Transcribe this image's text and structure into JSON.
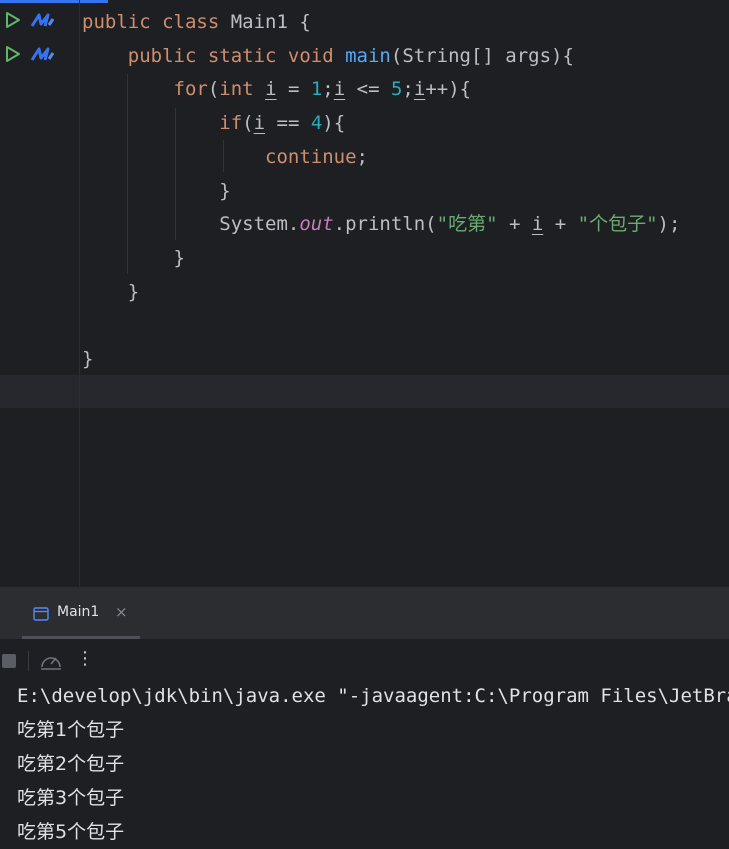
{
  "editor": {
    "code_lines": [
      [
        {
          "t": "public class ",
          "c": "kw"
        },
        {
          "t": "Main1 {",
          "c": ""
        }
      ],
      [
        {
          "t": "    public static void ",
          "c": "kw"
        },
        {
          "t": "main",
          "c": "fn"
        },
        {
          "t": "(String[] args){",
          "c": ""
        }
      ],
      [
        {
          "t": "        for",
          "c": "kw"
        },
        {
          "t": "(",
          "c": ""
        },
        {
          "t": "int ",
          "c": "kw"
        },
        {
          "t": "i",
          "c": "var"
        },
        {
          "t": " = ",
          "c": ""
        },
        {
          "t": "1",
          "c": "num"
        },
        {
          "t": ";",
          "c": ""
        },
        {
          "t": "i",
          "c": "var"
        },
        {
          "t": " <= ",
          "c": ""
        },
        {
          "t": "5",
          "c": "num"
        },
        {
          "t": ";",
          "c": ""
        },
        {
          "t": "i",
          "c": "var"
        },
        {
          "t": "++){",
          "c": ""
        }
      ],
      [
        {
          "t": "            if",
          "c": "kw"
        },
        {
          "t": "(",
          "c": ""
        },
        {
          "t": "i",
          "c": "var"
        },
        {
          "t": " == ",
          "c": ""
        },
        {
          "t": "4",
          "c": "num"
        },
        {
          "t": "){",
          "c": ""
        }
      ],
      [
        {
          "t": "                continue",
          "c": "kw"
        },
        {
          "t": ";",
          "c": ""
        }
      ],
      [
        {
          "t": "            }",
          "c": ""
        }
      ],
      [
        {
          "t": "            System.",
          "c": ""
        },
        {
          "t": "out",
          "c": "fld"
        },
        {
          "t": ".println(",
          "c": ""
        },
        {
          "t": "\"吃第\"",
          "c": "str"
        },
        {
          "t": " + ",
          "c": ""
        },
        {
          "t": "i",
          "c": "var"
        },
        {
          "t": " + ",
          "c": ""
        },
        {
          "t": "\"个包子\"",
          "c": "str"
        },
        {
          "t": ");",
          "c": ""
        }
      ],
      [
        {
          "t": "        }",
          "c": ""
        }
      ],
      [
        {
          "t": "    }",
          "c": ""
        }
      ],
      [
        {
          "t": "",
          "c": ""
        }
      ],
      [
        {
          "t": "}",
          "c": ""
        }
      ]
    ]
  },
  "run_panel": {
    "tab_label": "Main1",
    "tab_close": "×",
    "more_label": "⋮",
    "console_lines": [
      "E:\\develop\\jdk\\bin\\java.exe \"-javaagent:C:\\Program Files\\JetBrains",
      "吃第1个包子",
      "吃第2个包子",
      "吃第3个包子",
      "吃第5个包子"
    ]
  },
  "icons": {
    "run": "run-icon",
    "modifier": "method-icon",
    "window": "window-icon",
    "stop": "stop-icon",
    "gauge": "gauge-icon",
    "more": "more-vertical-icon"
  },
  "colors": {
    "background": "#1e1f22",
    "keyword": "#cf8e6d",
    "function": "#56a8f5",
    "number": "#2aacb8",
    "string": "#6aab73",
    "field": "#c77dbb",
    "run_green": "#5fb865",
    "accent": "#3574f0"
  }
}
